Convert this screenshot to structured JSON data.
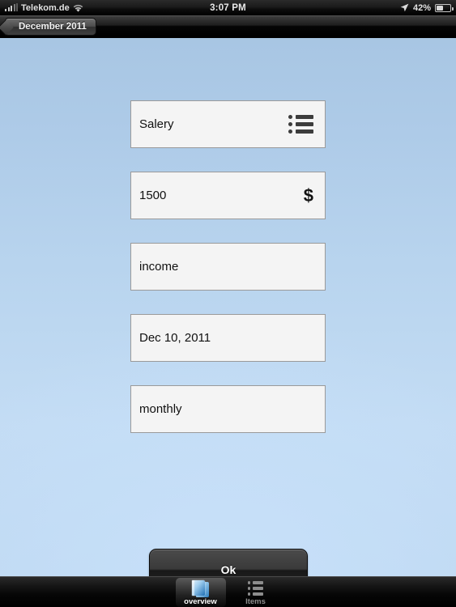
{
  "status_bar": {
    "carrier": "Telekom.de",
    "signal_icon": "signal-bars-icon",
    "wifi_icon": "wifi-icon",
    "time": "3:07 PM",
    "location_icon": "location-arrow-icon",
    "battery_percent": "42%",
    "battery_level": 42,
    "battery_icon": "battery-icon"
  },
  "nav_bar": {
    "back_label": "December 2011",
    "back_icon": "chevron-left-icon"
  },
  "form": {
    "fields": [
      {
        "name": "title",
        "value": "Salery",
        "accessory": "list-bullet-icon"
      },
      {
        "name": "amount",
        "value": "1500",
        "accessory": "dollar-sign-icon",
        "accessory_text": "$"
      },
      {
        "name": "type",
        "value": "income",
        "accessory": "none"
      },
      {
        "name": "date",
        "value": "Dec 10, 2011",
        "accessory": "none"
      },
      {
        "name": "recurrence",
        "value": "monthly",
        "accessory": "none"
      }
    ],
    "submit_label": "Ok"
  },
  "tab_bar": {
    "items": [
      {
        "label": "overview",
        "icon": "book-icon",
        "selected": true
      },
      {
        "label": "Items",
        "icon": "list-bullet-icon",
        "selected": false
      }
    ]
  },
  "colors": {
    "background_top": "#a8c6e3",
    "background_bottom": "#c3dcf4",
    "field_fill": "#f4f4f4",
    "field_border": "#9a9a9a",
    "chrome_black": "#000000",
    "tab_selected_text": "#ffffff",
    "tab_idle_text": "#8d8d8d",
    "book_accent": "#1f6fb4"
  }
}
